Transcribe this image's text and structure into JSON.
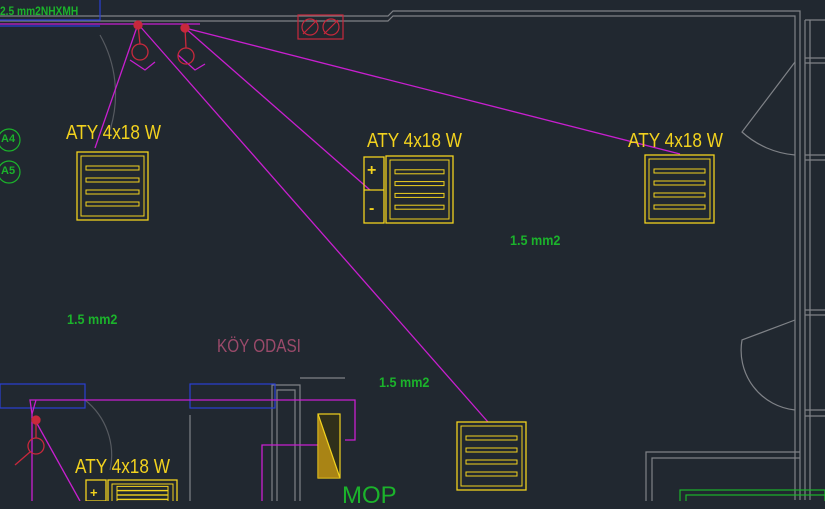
{
  "drawing": {
    "top_note": "2.5 mm2NHXMH",
    "room_label": "KÖY ODASI",
    "mop_label": "MOP",
    "circuits": [
      "A4",
      "A5"
    ],
    "panel_signs": {
      "plus": "+",
      "minus": "-"
    },
    "fixtures": [
      {
        "label": "ATY 4x18 W"
      },
      {
        "label": "ATY 4x18 W"
      },
      {
        "label": "ATY 4x18 W"
      },
      {
        "label": ""
      },
      {
        "label": "ATY 4x18 W"
      }
    ],
    "cable_labels": [
      "1.5 mm2",
      "1.5 mm2",
      "1.5 mm2"
    ],
    "colors": {
      "background": "#212830",
      "walls": "#7f8287",
      "fixture": "#f2d21e",
      "wiring": "#c81fcf",
      "text_green": "#1bb32b",
      "room_text": "#9a4a6a",
      "cad_blue": "#2a3fd4",
      "outlet_red": "#c8283c"
    }
  }
}
